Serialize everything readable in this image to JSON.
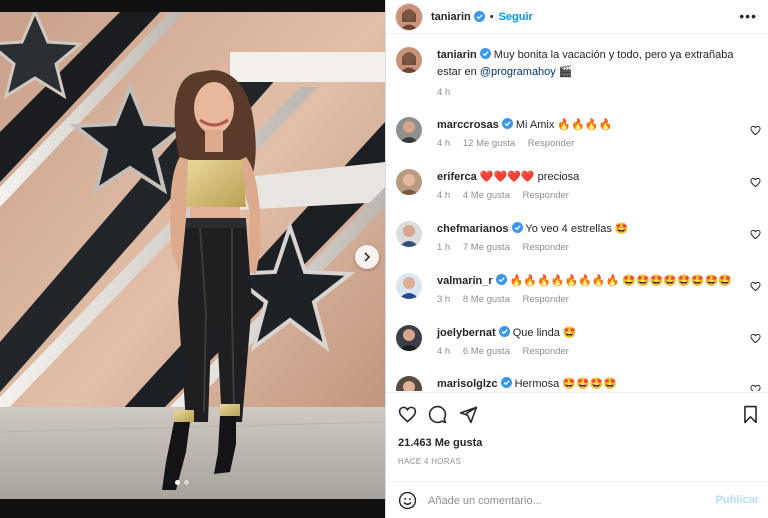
{
  "post": {
    "username": "taniarin",
    "follow_label": "Seguir",
    "separator": "•",
    "more_label": "•••",
    "caption_part1": "Muy bonita la vacación y todo, pero ya extrañaba estar en ",
    "caption_mention": "@programahoy",
    "caption_emoji": "🎬",
    "caption_time": "4 h",
    "likes": "21.463 Me gusta",
    "time_ago": "HACE 4 HORAS",
    "carousel_pages": 2,
    "carousel_active": 1
  },
  "comments": [
    {
      "username": "marccrosas",
      "verified": true,
      "text": "Mi Amix 🔥🔥🔥🔥",
      "time": "4 h",
      "likes": "12 Me gusta",
      "reply": "Responder"
    },
    {
      "username": "eriferca",
      "verified": false,
      "text": "❤️❤️❤️❤️ preciosa",
      "time": "4 h",
      "likes": "4 Me gusta",
      "reply": "Responder"
    },
    {
      "username": "chefmarianos",
      "verified": true,
      "text": "Yo veo 4 estrellas 🤩",
      "time": "1 h",
      "likes": "7 Me gusta",
      "reply": "Responder"
    },
    {
      "username": "valmarin_r",
      "verified": true,
      "text": "🔥🔥🔥🔥🔥🔥🔥🔥 🤩🤩🤩🤩🤩🤩🤩🤩",
      "time": "3 h",
      "likes": "8 Me gusta",
      "reply": "Responder"
    },
    {
      "username": "joelybernat",
      "verified": true,
      "text": "Que linda 🤩",
      "time": "4 h",
      "likes": "6 Me gusta",
      "reply": "Responder"
    },
    {
      "username": "marisolglzc",
      "verified": true,
      "text": "Hermosa 🤩🤩🤩🤩",
      "time": "",
      "likes": "",
      "reply": ""
    }
  ],
  "add_comment": {
    "placeholder": "Añade un comentario...",
    "publish_label": "Publicar"
  },
  "colors": {
    "accent": "#0095f6",
    "verified": "#3897f0",
    "text": "#262626",
    "muted": "#8e8e8e"
  },
  "icons": [
    "verified-badge-icon",
    "more-icon",
    "heart-icon",
    "comment-icon",
    "share-icon",
    "bookmark-icon",
    "emoji-icon",
    "chevron-right-icon"
  ]
}
